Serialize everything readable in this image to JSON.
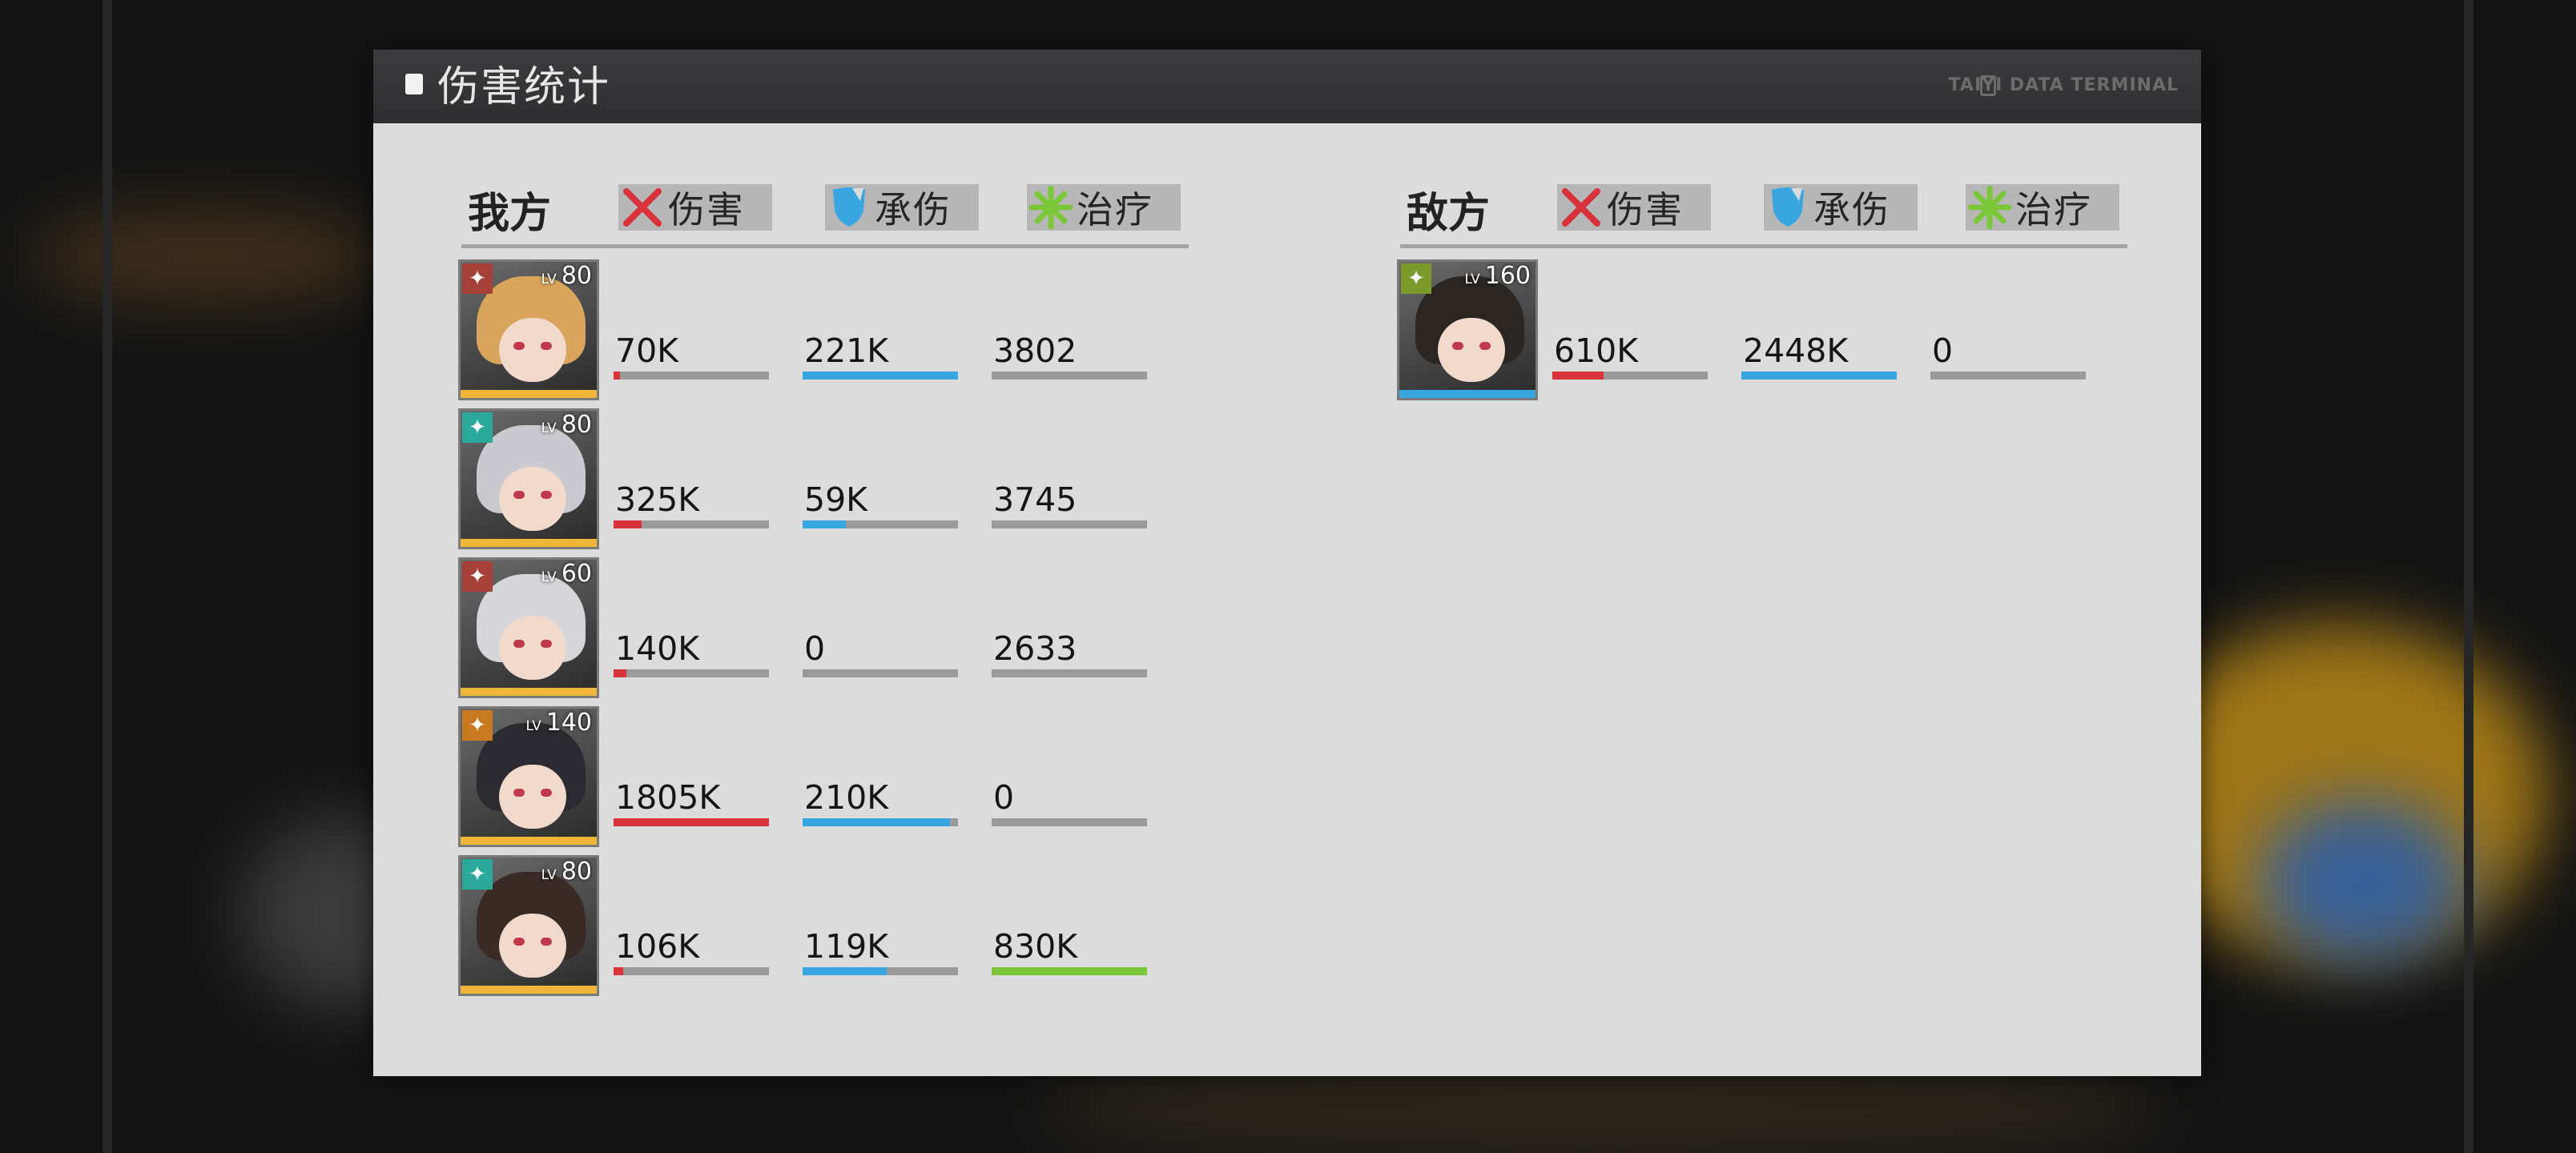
{
  "window": {
    "title": "伤害统计",
    "terminal_label": "TAIYI DATA TERMINAL"
  },
  "colors": {
    "damage": "#d8323a",
    "taken": "#3aa6e0",
    "heal": "#7cc63a",
    "track": "#9a9a9a"
  },
  "categories": [
    {
      "key": "damage",
      "label": "伤害",
      "icon": "cross-swords-icon"
    },
    {
      "key": "taken",
      "label": "承伤",
      "icon": "shield-icon"
    },
    {
      "key": "heal",
      "label": "治疗",
      "icon": "heal-burst-icon"
    }
  ],
  "ally": {
    "label": "我方",
    "members": [
      {
        "level": "80",
        "element": "blade",
        "element_color": "#a8403a",
        "hair": "#d9a45c",
        "damage": {
          "value": "70K",
          "fraction": 0.04
        },
        "taken": {
          "value": "221K",
          "fraction": 1.0
        },
        "heal": {
          "value": "3802",
          "fraction": 0.0
        }
      },
      {
        "level": "80",
        "element": "wind",
        "element_color": "#2aa89a",
        "hair": "#c9c9cf",
        "damage": {
          "value": "325K",
          "fraction": 0.18
        },
        "taken": {
          "value": "59K",
          "fraction": 0.28
        },
        "heal": {
          "value": "3745",
          "fraction": 0.0
        }
      },
      {
        "level": "60",
        "element": "blade",
        "element_color": "#a8403a",
        "hair": "#d6d6da",
        "damage": {
          "value": "140K",
          "fraction": 0.08
        },
        "taken": {
          "value": "0",
          "fraction": 0.0
        },
        "heal": {
          "value": "2633",
          "fraction": 0.0
        }
      },
      {
        "level": "140",
        "element": "flame",
        "element_color": "#c97a20",
        "hair": "#2a2a30",
        "damage": {
          "value": "1805K",
          "fraction": 1.0
        },
        "taken": {
          "value": "210K",
          "fraction": 0.95
        },
        "heal": {
          "value": "0",
          "fraction": 0.0
        }
      },
      {
        "level": "80",
        "element": "wind",
        "element_color": "#2aa89a",
        "hair": "#3a2a26",
        "damage": {
          "value": "106K",
          "fraction": 0.06
        },
        "taken": {
          "value": "119K",
          "fraction": 0.54
        },
        "heal": {
          "value": "830K",
          "fraction": 1.0
        }
      }
    ]
  },
  "enemy": {
    "label": "敌方",
    "members": [
      {
        "level": "160",
        "element": "leaf",
        "element_color": "#7a9a2a",
        "hair": "#2c2622",
        "damage": {
          "value": "610K",
          "fraction": 0.33
        },
        "taken": {
          "value": "2448K",
          "fraction": 1.0
        },
        "heal": {
          "value": "0",
          "fraction": 0.0
        }
      }
    ]
  }
}
